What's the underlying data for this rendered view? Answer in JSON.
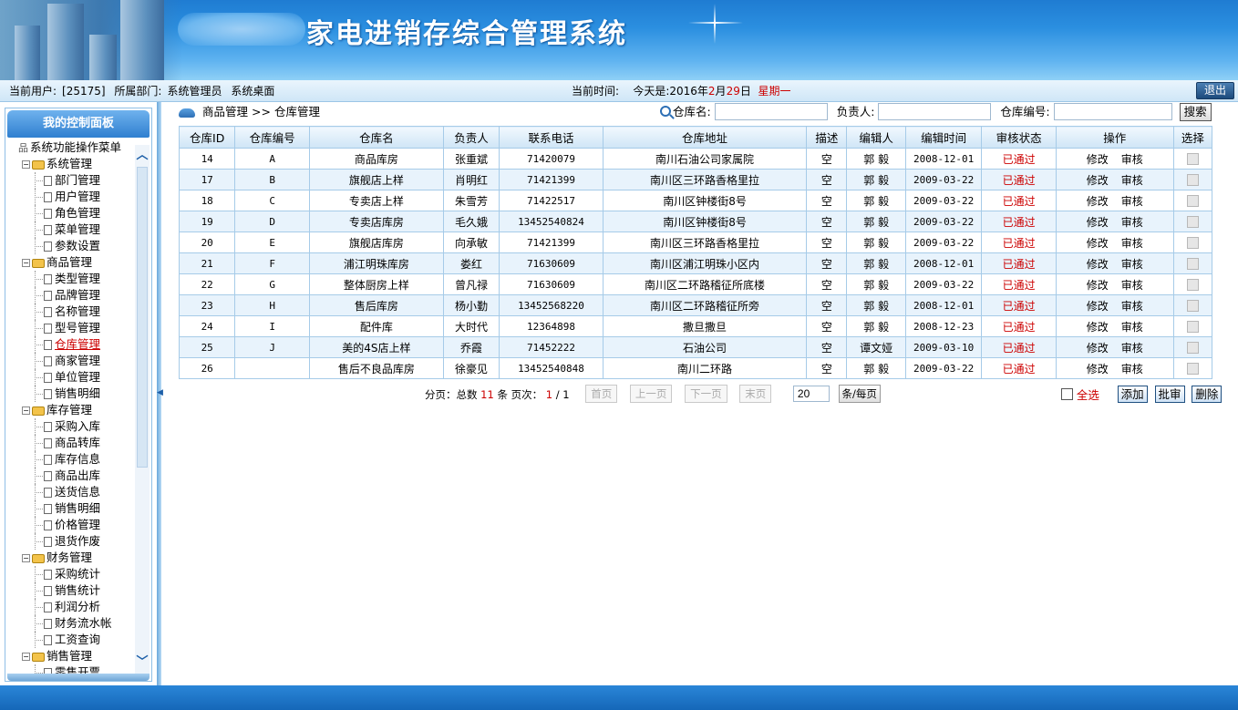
{
  "header": {
    "title": "家电进销存综合管理系统"
  },
  "infobar": {
    "current_user_label": "当前用户:",
    "current_user": "[25175]",
    "dept_label": "所属部门:",
    "dept": "系统管理员",
    "desktop": "系统桌面",
    "time_label": "当前时间:",
    "today_prefix": "今天是:",
    "year": "2016年",
    "month": "2",
    "month_unit": "月",
    "day": "29",
    "day_unit": "日",
    "weekday": "星期一",
    "logout": "退出"
  },
  "sidebar": {
    "panel_title": "我的控制面板",
    "root": "系统功能操作菜单",
    "groups": [
      {
        "label": "系统管理",
        "items": [
          "部门管理",
          "用户管理",
          "角色管理",
          "菜单管理",
          "参数设置"
        ]
      },
      {
        "label": "商品管理",
        "items": [
          "类型管理",
          "品牌管理",
          "名称管理",
          "型号管理",
          "仓库管理",
          "商家管理",
          "单位管理",
          "销售明细"
        ]
      },
      {
        "label": "库存管理",
        "items": [
          "采购入库",
          "商品转库",
          "库存信息",
          "商品出库",
          "送货信息",
          "销售明细",
          "价格管理",
          "退货作废"
        ]
      },
      {
        "label": "财务管理",
        "items": [
          "采购统计",
          "销售统计",
          "利润分析",
          "财务流水帐",
          "工资查询"
        ]
      },
      {
        "label": "销售管理",
        "items": [
          "零售开票"
        ]
      }
    ],
    "active_item": "仓库管理"
  },
  "breadcrumb": {
    "parent": "商品管理",
    "sep": ">>",
    "current": "仓库管理"
  },
  "search": {
    "name_label": "仓库名:",
    "owner_label": "负责人:",
    "code_label": "仓库编号:",
    "button": "搜索"
  },
  "table": {
    "headers": [
      "仓库ID",
      "仓库编号",
      "仓库名",
      "负责人",
      "联系电话",
      "仓库地址",
      "描述",
      "编辑人",
      "编辑时间",
      "审核状态",
      "操作",
      "选择"
    ],
    "edit_label": "修改",
    "audit_label": "审核",
    "rows": [
      {
        "id": "14",
        "code": "A",
        "name": "商品库房",
        "owner": "张重斌",
        "phone": "71420079",
        "address": "南川石油公司家属院",
        "desc": "空",
        "editor": "郭 毅",
        "time": "2008-12-01",
        "status": "已通过"
      },
      {
        "id": "17",
        "code": "B",
        "name": "旗舰店上样",
        "owner": "肖明红",
        "phone": "71421399",
        "address": "南川区三环路香格里拉",
        "desc": "空",
        "editor": "郭 毅",
        "time": "2009-03-22",
        "status": "已通过"
      },
      {
        "id": "18",
        "code": "C",
        "name": "专卖店上样",
        "owner": "朱雪芳",
        "phone": "71422517",
        "address": "南川区钟楼街8号",
        "desc": "空",
        "editor": "郭 毅",
        "time": "2009-03-22",
        "status": "已通过"
      },
      {
        "id": "19",
        "code": "D",
        "name": "专卖店库房",
        "owner": "毛久娥",
        "phone": "13452540824",
        "address": "南川区钟楼街8号",
        "desc": "空",
        "editor": "郭 毅",
        "time": "2009-03-22",
        "status": "已通过"
      },
      {
        "id": "20",
        "code": "E",
        "name": "旗舰店库房",
        "owner": "向承敏",
        "phone": "71421399",
        "address": "南川区三环路香格里拉",
        "desc": "空",
        "editor": "郭 毅",
        "time": "2009-03-22",
        "status": "已通过"
      },
      {
        "id": "21",
        "code": "F",
        "name": "浦江明珠库房",
        "owner": "娄红",
        "phone": "71630609",
        "address": "南川区浦江明珠小区内",
        "desc": "空",
        "editor": "郭 毅",
        "time": "2008-12-01",
        "status": "已通过"
      },
      {
        "id": "22",
        "code": "G",
        "name": "整体厨房上样",
        "owner": "曾凡禄",
        "phone": "71630609",
        "address": "南川区二环路稽征所底楼",
        "desc": "空",
        "editor": "郭 毅",
        "time": "2009-03-22",
        "status": "已通过"
      },
      {
        "id": "23",
        "code": "H",
        "name": "售后库房",
        "owner": "杨小勤",
        "phone": "13452568220",
        "address": "南川区二环路稽征所旁",
        "desc": "空",
        "editor": "郭 毅",
        "time": "2008-12-01",
        "status": "已通过"
      },
      {
        "id": "24",
        "code": "I",
        "name": "配件库",
        "owner": "大时代",
        "phone": "12364898",
        "address": "撒旦撒旦",
        "desc": "空",
        "editor": "郭 毅",
        "time": "2008-12-23",
        "status": "已通过"
      },
      {
        "id": "25",
        "code": "J",
        "name": "美的4S店上样",
        "owner": "乔霞",
        "phone": "71452222",
        "address": "石油公司",
        "desc": "空",
        "editor": "谭文娅",
        "time": "2009-03-10",
        "status": "已通过"
      },
      {
        "id": "26",
        "code": "",
        "name": "售后不良品库房",
        "owner": "徐豪见",
        "phone": "13452540848",
        "address": "南川二环路",
        "desc": "空",
        "editor": "郭 毅",
        "time": "2009-03-22",
        "status": "已通过"
      }
    ]
  },
  "pager": {
    "label": "分页：总数",
    "total": "11",
    "mid": "条 页次：",
    "page": "1",
    "slash": "/",
    "pages": "1",
    "first": "首页",
    "prev": "上一页",
    "next": "下一页",
    "last": "末页",
    "page_size": "20",
    "per_page": "条/每页"
  },
  "actions": {
    "select_all": "全选",
    "add": "添加",
    "batch_audit": "批审",
    "delete": "删除"
  },
  "colors": {
    "accent": "#2b8fe0",
    "status_red": "#cc0000"
  }
}
